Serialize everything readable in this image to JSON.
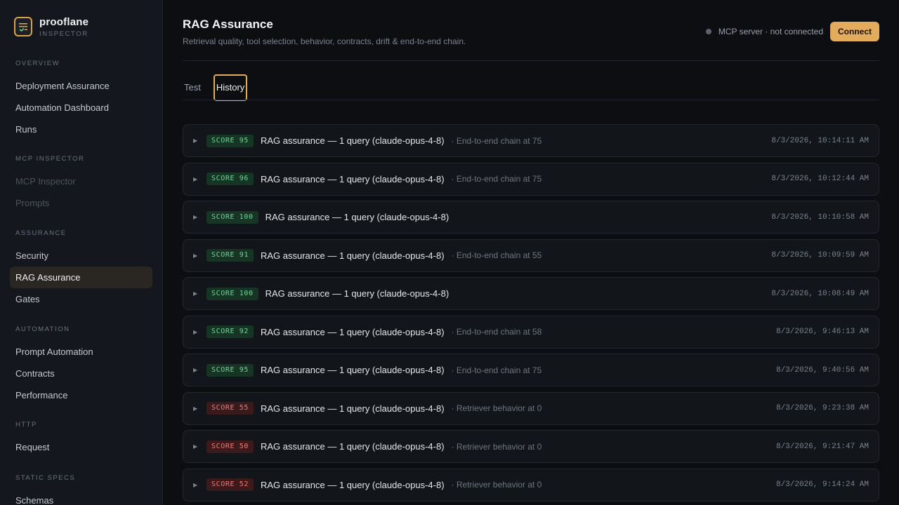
{
  "brand": {
    "name": "prooflane",
    "subtitle": "INSPECTOR"
  },
  "sidebar": {
    "sections": [
      {
        "heading": "OVERVIEW",
        "items": [
          "Deployment Assurance",
          "Automation Dashboard",
          "Runs"
        ]
      },
      {
        "heading": "MCP INSPECTOR",
        "items": [
          "MCP Inspector",
          "Prompts"
        ]
      },
      {
        "heading": "ASSURANCE",
        "items": [
          "Security",
          "RAG Assurance",
          "Gates"
        ]
      },
      {
        "heading": "AUTOMATION",
        "items": [
          "Prompt Automation",
          "Contracts",
          "Performance"
        ]
      },
      {
        "heading": "HTTP",
        "items": [
          "Request"
        ]
      },
      {
        "heading": "STATIC SPECS",
        "items": [
          "Schemas"
        ]
      }
    ],
    "active_item": "RAG Assurance"
  },
  "header": {
    "title": "RAG Assurance",
    "subtitle": "Retrieval quality, tool selection, behavior, contracts, drift & end-to-end chain.",
    "status": "MCP server · not connected",
    "connect_label": "Connect"
  },
  "tabs": {
    "test": "Test",
    "history": "History",
    "active": "History"
  },
  "colors": {
    "accent": "#e2ac5c",
    "score_good": "#6fd49a",
    "score_bad": "#f07a78"
  },
  "history": [
    {
      "score": "SCORE 95",
      "status": "good",
      "title": "RAG assurance — 1 query (claude-opus-4-8)",
      "note": "· End-to-end chain at 75",
      "time": "8/3/2026, 10:14:11 AM"
    },
    {
      "score": "SCORE 96",
      "status": "good",
      "title": "RAG assurance — 1 query (claude-opus-4-8)",
      "note": "· End-to-end chain at 75",
      "time": "8/3/2026, 10:12:44 AM"
    },
    {
      "score": "SCORE 100",
      "status": "good",
      "title": "RAG assurance — 1 query (claude-opus-4-8)",
      "note": "",
      "time": "8/3/2026, 10:10:58 AM"
    },
    {
      "score": "SCORE 91",
      "status": "good",
      "title": "RAG assurance — 1 query (claude-opus-4-8)",
      "note": "· End-to-end chain at 55",
      "time": "8/3/2026, 10:09:59 AM"
    },
    {
      "score": "SCORE 100",
      "status": "good",
      "title": "RAG assurance — 1 query (claude-opus-4-8)",
      "note": "",
      "time": "8/3/2026, 10:08:49 AM"
    },
    {
      "score": "SCORE 92",
      "status": "good",
      "title": "RAG assurance — 1 query (claude-opus-4-8)",
      "note": "· End-to-end chain at 58",
      "time": "8/3/2026, 9:46:13 AM"
    },
    {
      "score": "SCORE 95",
      "status": "good",
      "title": "RAG assurance — 1 query (claude-opus-4-8)",
      "note": "· End-to-end chain at 75",
      "time": "8/3/2026, 9:40:56 AM"
    },
    {
      "score": "SCORE 55",
      "status": "bad",
      "title": "RAG assurance — 1 query (claude-opus-4-8)",
      "note": "· Retriever behavior at 0",
      "time": "8/3/2026, 9:23:38 AM"
    },
    {
      "score": "SCORE 50",
      "status": "bad",
      "title": "RAG assurance — 1 query (claude-opus-4-8)",
      "note": "· Retriever behavior at 0",
      "time": "8/3/2026, 9:21:47 AM"
    },
    {
      "score": "SCORE 52",
      "status": "bad",
      "title": "RAG assurance — 1 query (claude-opus-4-8)",
      "note": "· Retriever behavior at 0",
      "time": "8/3/2026, 9:14:24 AM"
    }
  ]
}
